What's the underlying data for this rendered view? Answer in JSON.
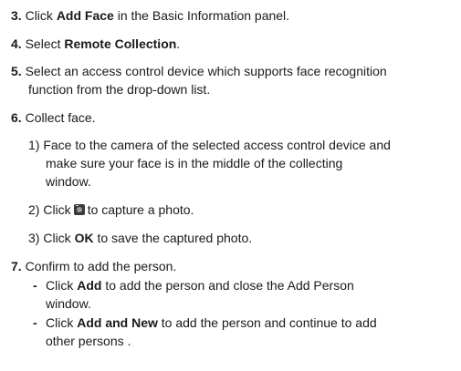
{
  "steps": {
    "step3": {
      "num": "3.",
      "pre": "Click ",
      "bold": "Add Face",
      "post": " in the Basic Information panel."
    },
    "step4": {
      "num": "4.",
      "pre": "Select ",
      "bold": "Remote Collection",
      "post": "."
    },
    "step5": {
      "num": "5.",
      "line1": "Select an access control device which supports face recognition",
      "line2": "function from the drop-down list."
    },
    "step6": {
      "num": "6.",
      "text": "Collect face.",
      "sub1": {
        "num": "1)",
        "line1": "Face to the camera of the selected access control device and",
        "line2": "make sure your face is in the middle of the collecting",
        "line3": "window."
      },
      "sub2": {
        "num": "2)",
        "pre": "Click",
        "icon": "camera-icon",
        "post": "to capture a photo."
      },
      "sub3": {
        "num": "3)",
        "pre": "Click ",
        "bold": "OK",
        "post": " to save the captured photo."
      }
    },
    "step7": {
      "num": "7.",
      "text": "Confirm to add the person.",
      "bullet1": {
        "dash": "-",
        "pre": "Click ",
        "bold": "Add",
        "post": " to add the person and close the Add Person",
        "line2": "window."
      },
      "bullet2": {
        "dash": "-",
        "pre": "Click ",
        "bold": "Add and New",
        "post": " to add the person and continue to add",
        "line2": "other persons ."
      }
    }
  }
}
